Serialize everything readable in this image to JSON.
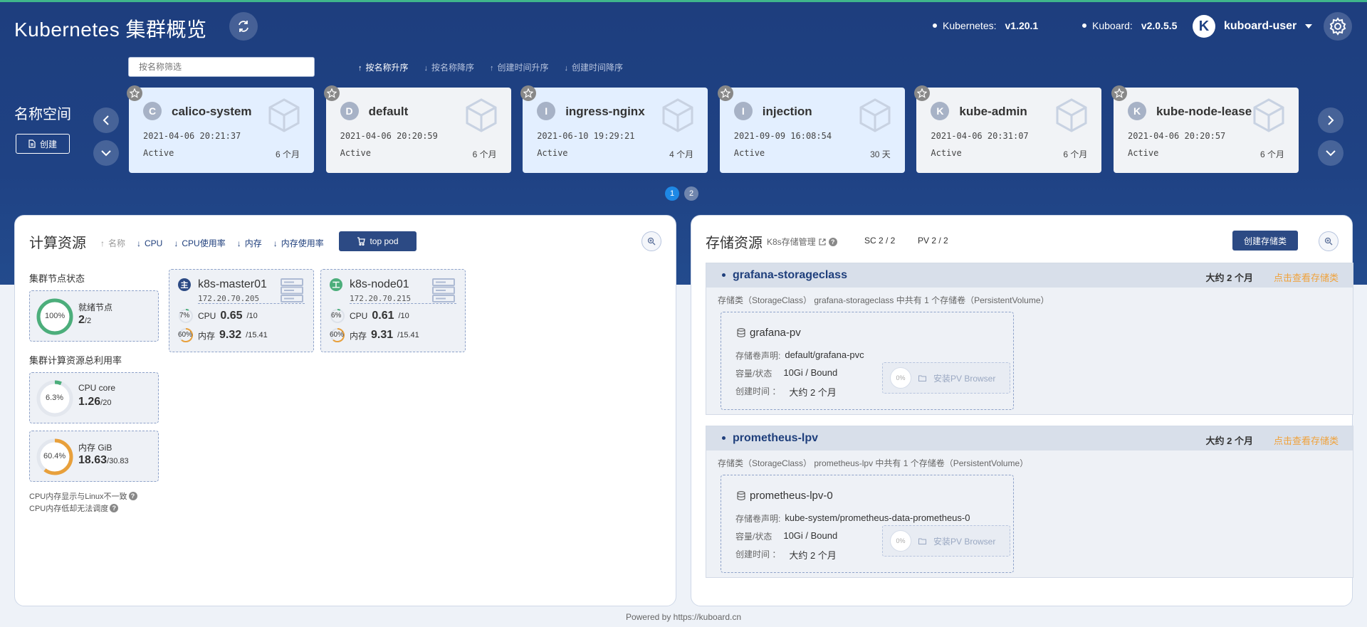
{
  "header": {
    "title": "Kubernetes 集群概览",
    "kubernetes_label": "Kubernetes:",
    "kubernetes_version": "v1.20.1",
    "kuboard_label": "Kuboard:",
    "kuboard_version": "v2.0.5.5",
    "user_initial": "K",
    "user_name": "kuboard-user"
  },
  "namespaces": {
    "section_label": "名称空间",
    "create_label": "创建",
    "filter_placeholder": "按名称筛选",
    "sorts": [
      "按名称升序",
      "按名称降序",
      "创建时间升序",
      "创建时间降序"
    ],
    "cards": [
      {
        "letter": "C",
        "name": "calico-system",
        "date": "2021-04-06 20:21:37",
        "status": "Active",
        "age": "6 个月"
      },
      {
        "letter": "D",
        "name": "default",
        "date": "2021-04-06 20:20:59",
        "status": "Active",
        "age": "6 个月"
      },
      {
        "letter": "I",
        "name": "ingress-nginx",
        "date": "2021-06-10 19:29:21",
        "status": "Active",
        "age": "4 个月"
      },
      {
        "letter": "I",
        "name": "injection",
        "date": "2021-09-09 16:08:54",
        "status": "Active",
        "age": "30 天"
      },
      {
        "letter": "K",
        "name": "kube-admin",
        "date": "2021-04-06 20:31:07",
        "status": "Active",
        "age": "6 个月"
      },
      {
        "letter": "K",
        "name": "kube-node-lease",
        "date": "2021-04-06 20:20:57",
        "status": "Active",
        "age": "6 个月"
      }
    ],
    "pages": [
      "1",
      "2"
    ]
  },
  "compute": {
    "title": "计算资源",
    "sorts": [
      "名称",
      "CPU",
      "CPU使用率",
      "内存",
      "内存使用率"
    ],
    "top_pod": "top pod",
    "node_status_label": "集群节点状态",
    "ready_ring": "100%",
    "ready_fraction": 1.0,
    "ready_title": "就绪节点",
    "ready_value": "2",
    "ready_total": "/2",
    "usage_label": "集群计算资源总利用率",
    "cpu_ring": "6.3%",
    "cpu_fraction": 0.063,
    "cpu_title": "CPU core",
    "cpu_value": "1.26",
    "cpu_total": "/20",
    "mem_ring": "60.4%",
    "mem_fraction": 0.604,
    "mem_title": "内存 GiB",
    "mem_value": "18.63",
    "mem_total": "/30.83",
    "note1": "CPU内存显示与Linux不一致",
    "note2": "CPU内存低却无法调度",
    "nodes": [
      {
        "badge": "主",
        "name": "k8s-master01",
        "ip": "172.20.70.205",
        "cpu_pct": "7%",
        "cpu_label": "CPU",
        "cpu": "0.65",
        "cpu_total": "/10",
        "mem_pct": "60%",
        "mem_label": "内存",
        "mem": "9.32",
        "mem_total": "/15.41"
      },
      {
        "badge": "工",
        "name": "k8s-node01",
        "ip": "172.20.70.215",
        "cpu_pct": "6%",
        "cpu_label": "CPU",
        "cpu": "0.61",
        "cpu_total": "/10",
        "mem_pct": "60%",
        "mem_label": "内存",
        "mem": "9.31",
        "mem_total": "/15.41"
      }
    ]
  },
  "storage": {
    "title": "存储资源",
    "k8s_link": "K8s存储管理",
    "sc_count": "SC 2 / 2",
    "pv_count": "PV 2 / 2",
    "create_label": "创建存储类",
    "classes": [
      {
        "name": "grafana-storageclass",
        "age": "大约 2 个月",
        "link": "点击查看存储类",
        "desc": "存储类（StorageClass） grafana-storageclass 中共有 1 个存储卷（PersistentVolume）",
        "pv_name": "grafana-pv",
        "claim_label": "存储卷声明:",
        "claim": "default/grafana-pvc",
        "cap_label": "容量/状态",
        "cap": "10Gi / Bound",
        "time_label": "创建时间 ：",
        "time": "大约 2 个月",
        "usage": "0%",
        "browser": "安装PV Browser"
      },
      {
        "name": "prometheus-lpv",
        "age": "大约 2 个月",
        "link": "点击查看存储类",
        "desc": "存储类（StorageClass） prometheus-lpv 中共有 1 个存储卷（PersistentVolume）",
        "pv_name": "prometheus-lpv-0",
        "claim_label": "存储卷声明:",
        "claim": "kube-system/prometheus-data-prometheus-0",
        "cap_label": "容量/状态",
        "cap": "10Gi / Bound",
        "time_label": "创建时间 ：",
        "time": "大约 2 个月",
        "usage": "0%",
        "browser": "安装PV Browser"
      }
    ]
  },
  "footer": "Powered by https://kuboard.cn",
  "colors": {
    "header": "#1f4284",
    "accent": "#2c4a84",
    "green": "#4cae7b",
    "orange": "#e8a03b",
    "link": "#f0a23b"
  }
}
